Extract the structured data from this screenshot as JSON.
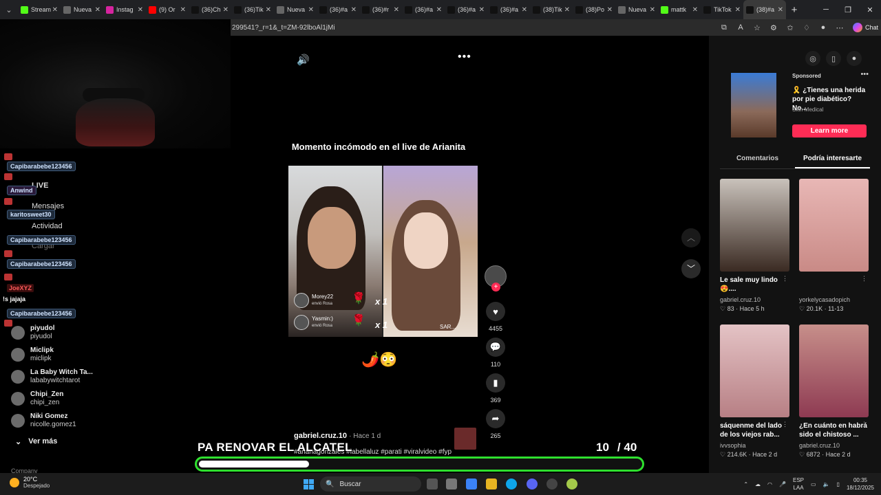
{
  "browser": {
    "tabs": [
      {
        "label": "Stream",
        "favicon_color": "#53fc18",
        "favicon_icon": "kick-icon"
      },
      {
        "label": "Nueva",
        "favicon_color": "#666666",
        "favicon_icon": "page-icon"
      },
      {
        "label": "Instag",
        "favicon_color": "#d6249f",
        "favicon_icon": "instagram-icon"
      },
      {
        "label": "(9) Or",
        "favicon_color": "#ff0000",
        "favicon_icon": "youtube-icon"
      },
      {
        "label": "(36)Ch",
        "favicon_color": "#111111",
        "favicon_icon": "tiktok-icon"
      },
      {
        "label": "(36)Tik",
        "favicon_color": "#111111",
        "favicon_icon": "tiktok-icon"
      },
      {
        "label": "Nueva",
        "favicon_color": "#666666",
        "favicon_icon": "page-icon"
      },
      {
        "label": "(36)#a",
        "favicon_color": "#111111",
        "favicon_icon": "tiktok-icon"
      },
      {
        "label": "(36)#r",
        "favicon_color": "#111111",
        "favicon_icon": "tiktok-icon"
      },
      {
        "label": "(36)#a",
        "favicon_color": "#111111",
        "favicon_icon": "tiktok-icon"
      },
      {
        "label": "(36)#a",
        "favicon_color": "#111111",
        "favicon_icon": "tiktok-icon"
      },
      {
        "label": "(36)#a",
        "favicon_color": "#111111",
        "favicon_icon": "tiktok-icon"
      },
      {
        "label": "(38)Tik",
        "favicon_color": "#111111",
        "favicon_icon": "tiktok-icon"
      },
      {
        "label": "(38)Po",
        "favicon_color": "#111111",
        "favicon_icon": "tiktok-icon"
      },
      {
        "label": "Nueva",
        "favicon_color": "#666666",
        "favicon_icon": "page-icon"
      },
      {
        "label": "mattk",
        "favicon_color": "#53fc18",
        "favicon_icon": "kick-icon"
      },
      {
        "label": "TikTok",
        "favicon_color": "#111111",
        "favicon_icon": "tiktok-icon"
      },
      {
        "label": "(38)#a",
        "favicon_color": "#111111",
        "favicon_icon": "tiktok-icon",
        "active": true
      }
    ],
    "url": "299541?_r=1&_t=ZM-92lboAl1jMi",
    "copilot_label": "Chat"
  },
  "stream_chat": [
    {
      "user": "Capibarabebe123456",
      "kind": "name"
    },
    {
      "user": "Anwind",
      "kind": "name"
    },
    {
      "user": "karitosweet30",
      "kind": "name"
    },
    {
      "user": "Capibarabebe123456",
      "kind": "name"
    },
    {
      "user": "Capibarabebe123456",
      "kind": "name"
    },
    {
      "user": "JoeXYZ",
      "kind": "red"
    },
    {
      "message": "!s jajaja",
      "kind": "text"
    },
    {
      "user": "Capibarabebe123456",
      "kind": "name"
    }
  ],
  "tiktok_sidebar": {
    "nav": [
      "LIVE",
      "Mensajes",
      "Actividad",
      "Cargar"
    ],
    "followed": [
      {
        "name": "piyudol",
        "handle": "piyudol"
      },
      {
        "name": "Miclipk",
        "handle": "miclipk"
      },
      {
        "name": "La Baby Witch Ta...",
        "handle": "lababywitchtarot"
      },
      {
        "name": "Chipi_Zen",
        "handle": "chipi_zen"
      },
      {
        "name": "Niki Gomez",
        "handle": "nicolle.gomez1"
      }
    ],
    "see_more": "Ver más",
    "company": "Company"
  },
  "video": {
    "title": "Momento incómodo en el live de Arianita",
    "gifts": [
      {
        "user": "Morey22",
        "sub": "envió Rosa",
        "count": "x 1"
      },
      {
        "user": "Yasmin:)",
        "sub": "envió Rosa",
        "count": "x 1"
      }
    ],
    "sar_label": "SAR...",
    "emojis": "🌶️😳",
    "author": "gabriel.cruz.10",
    "ago": "Hace 1 d",
    "hashtags": "#arianagonzales #labellaluz #parati #viralvideo #fyp",
    "likes": "4455",
    "comments": "110",
    "saves": "369",
    "shares": "265"
  },
  "stream_overlay": {
    "text": "PA RENOVAR EL ALCATEL",
    "current": "10",
    "total": "/ 40",
    "progress": 0.25,
    "bar_color": "#2ee02e"
  },
  "right_panel": {
    "ad": {
      "sponsored": "Sponsored",
      "title": "🎗️ ¿Tienes una herida por pie diabético? No...",
      "brand": "Skin Medical",
      "cta": "Learn more"
    },
    "tabs": [
      "Comentarios",
      "Podría interesarte"
    ],
    "cards": [
      {
        "caption": "Le sale muy lindo 😍....",
        "user": "gabriel.cruz.10",
        "meta": "♡ 83 · Hace 5 h",
        "colors": [
          "#c9c2bb",
          "#3a2a22"
        ]
      },
      {
        "caption": "",
        "user": "yorkelycasadopich",
        "meta": "♡ 20.1K · 11-13",
        "colors": [
          "#e8b7b5",
          "#c98a86"
        ]
      },
      {
        "caption": "sáquenme del lado de los viejos rab...",
        "user": "ivvsophia",
        "meta": "♡ 214.6K · Hace 2 d",
        "colors": [
          "#e4c3c5",
          "#b77f84"
        ]
      },
      {
        "caption": "¿En cuánto en habrá sido el chistoso ...",
        "user": "gabriel.cruz.10",
        "meta": "♡ 6872 · Hace 2 d",
        "colors": [
          "#c78f8a",
          "#8e3a52"
        ]
      }
    ]
  },
  "taskbar": {
    "temp": "20°C",
    "weather": "Despejado",
    "search_placeholder": "Buscar",
    "lang1": "ESP",
    "lang2": "LAA",
    "time": "00:35",
    "date": "18/12/2025"
  }
}
